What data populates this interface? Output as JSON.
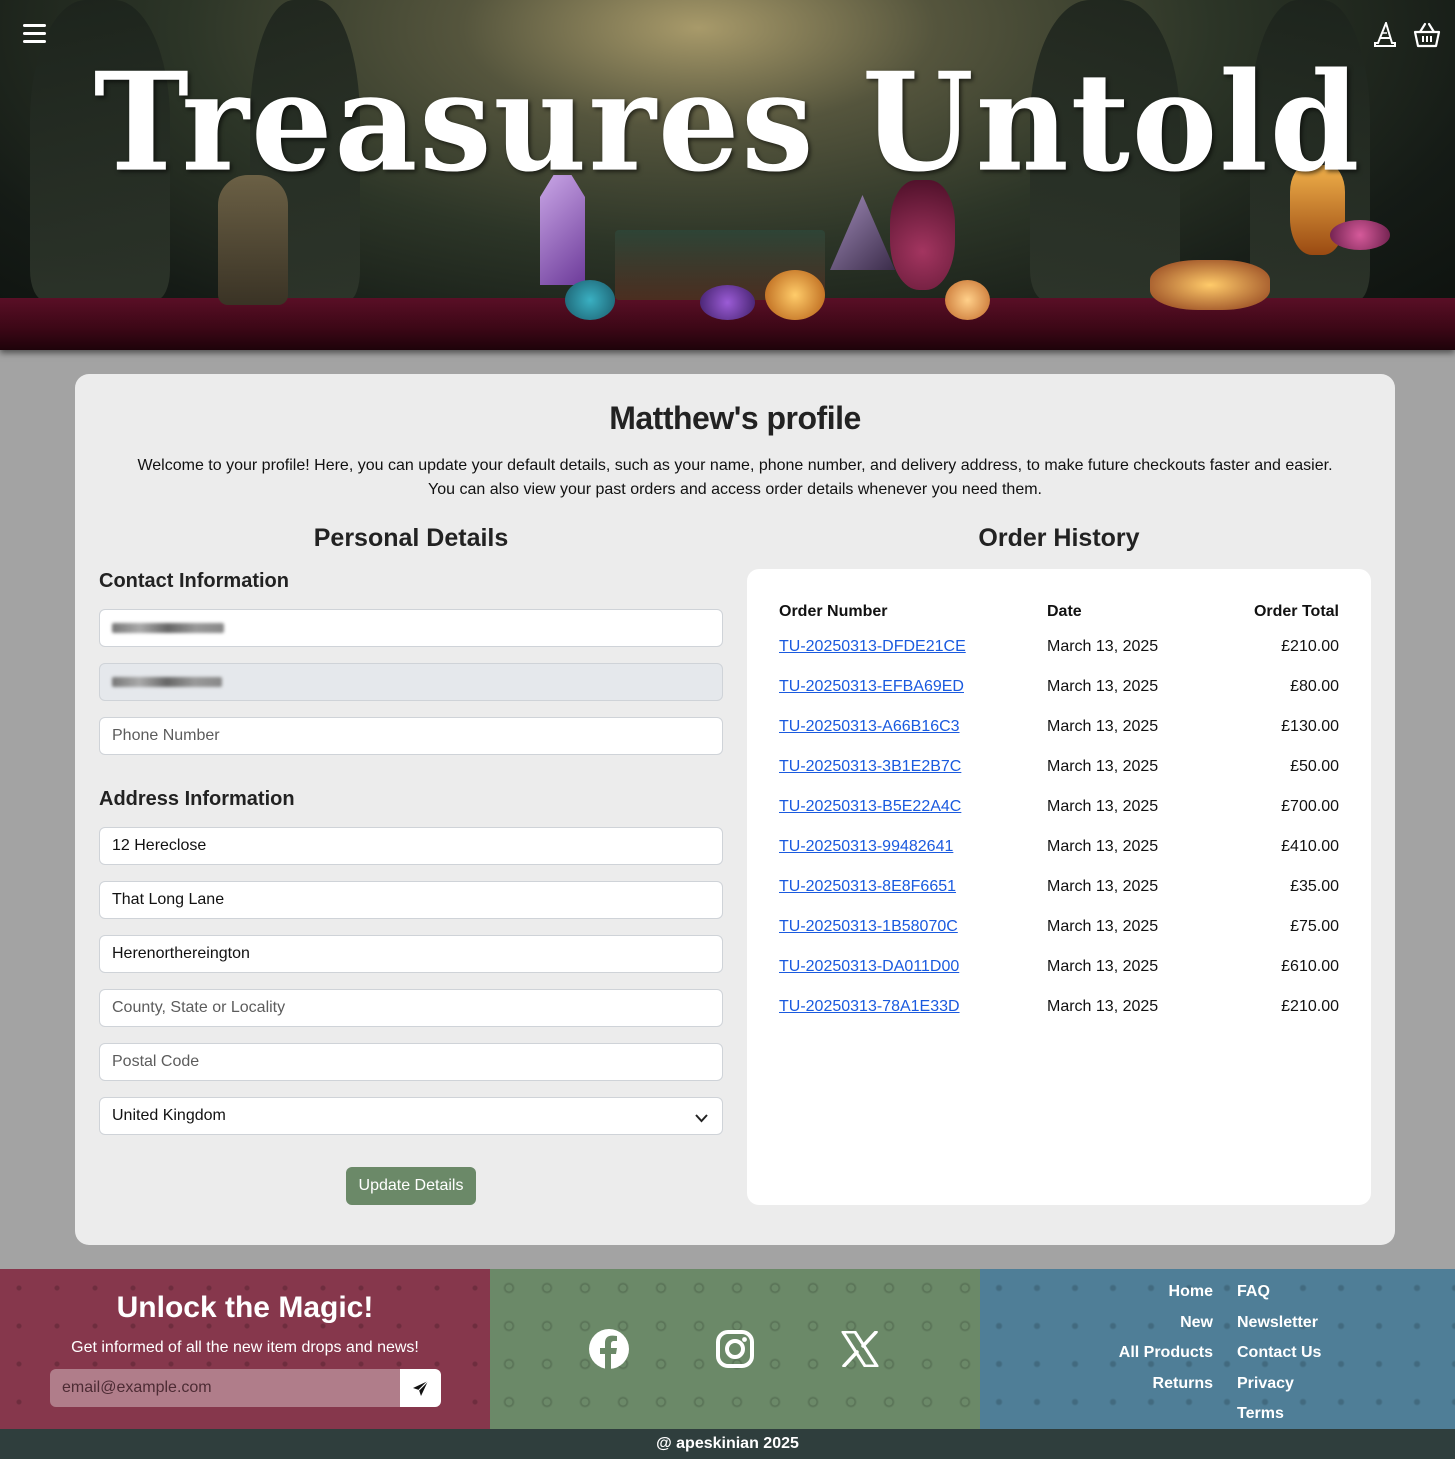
{
  "header": {
    "brand": "Treasures Untold",
    "colors": {
      "table": "#5a0f26",
      "forest": "#2c3527"
    }
  },
  "profile": {
    "title": "Matthew's profile",
    "intro_line1": "Welcome to your profile! Here, you can update your default details, such as your name, phone number, and delivery address, to make future checkouts faster and easier.",
    "intro_line2": "You can also view your past orders and access order details whenever you need them."
  },
  "personal": {
    "title": "Personal Details",
    "contact_title": "Contact Information",
    "phone_placeholder": "Phone Number",
    "address_title": "Address Information",
    "address1": "12 Hereclose",
    "address2": "That Long Lane",
    "town": "Herenorthereington",
    "county_placeholder": "County, State or Locality",
    "postcode_placeholder": "Postal Code",
    "country": "United Kingdom",
    "update_label": "Update Details"
  },
  "orders": {
    "title": "Order History",
    "headers": {
      "number": "Order Number",
      "date": "Date",
      "total": "Order Total"
    },
    "rows": [
      {
        "number": "TU-20250313-DFDE21CE",
        "date": "March 13, 2025",
        "total": "£210.00"
      },
      {
        "number": "TU-20250313-EFBA69ED",
        "date": "March 13, 2025",
        "total": "£80.00"
      },
      {
        "number": "TU-20250313-A66B16C3",
        "date": "March 13, 2025",
        "total": "£130.00"
      },
      {
        "number": "TU-20250313-3B1E2B7C",
        "date": "March 13, 2025",
        "total": "£50.00"
      },
      {
        "number": "TU-20250313-B5E22A4C",
        "date": "March 13, 2025",
        "total": "£700.00"
      },
      {
        "number": "TU-20250313-99482641",
        "date": "March 13, 2025",
        "total": "£410.00"
      },
      {
        "number": "TU-20250313-8E8F6651",
        "date": "March 13, 2025",
        "total": "£35.00"
      },
      {
        "number": "TU-20250313-1B58070C",
        "date": "March 13, 2025",
        "total": "£75.00"
      },
      {
        "number": "TU-20250313-DA011D00",
        "date": "March 13, 2025",
        "total": "£610.00"
      },
      {
        "number": "TU-20250313-78A1E33D",
        "date": "March 13, 2025",
        "total": "£210.00"
      }
    ]
  },
  "footer": {
    "newsletter_title": "Unlock the Magic!",
    "newsletter_sub": "Get informed of all the new item drops and news!",
    "email_placeholder": "email@example.com",
    "links_left": [
      "Home",
      "New",
      "All Products",
      "Returns"
    ],
    "links_right": [
      "FAQ",
      "Newsletter",
      "Contact Us",
      "Privacy",
      "Terms"
    ],
    "copyright": "@ apeskinian 2025",
    "colors": {
      "newsletter": "#86374c",
      "social": "#6b8968",
      "links": "#4f7e97",
      "bottom": "#2f3e3d"
    }
  }
}
